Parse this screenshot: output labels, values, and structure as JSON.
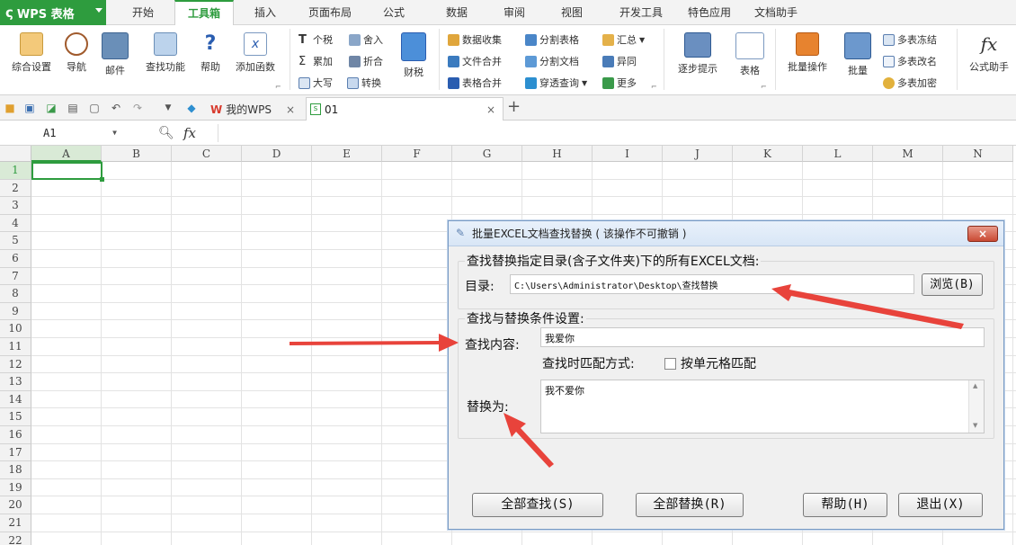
{
  "app": {
    "name": "WPS 表格"
  },
  "menu_tabs": [
    "开始",
    "工具箱",
    "插入",
    "页面布局",
    "公式",
    "数据",
    "审阅",
    "视图",
    "开发工具",
    "特色应用",
    "文档助手"
  ],
  "active_menu_tab": "工具箱",
  "ribbon": {
    "big_buttons": [
      "综合设置",
      "导航",
      "邮件",
      "查找功能",
      "帮助",
      "添加函数",
      "财税",
      "逐步提示",
      "表格",
      "批量操作",
      "批量",
      "公式助手"
    ],
    "small_buttons": [
      "个税",
      "舍入",
      "累加",
      "折合",
      "大写",
      "转换",
      "数据收集",
      "分割表格",
      "文件合并",
      "分割文档",
      "表格合并",
      "穿透查询",
      "汇总",
      "异同",
      "更多",
      "多表冻结",
      "多表改名",
      "多表加密"
    ]
  },
  "doc_tabs": [
    {
      "label": "我的WPS"
    },
    {
      "label": "01"
    }
  ],
  "formula_bar": {
    "cell_ref": "A1",
    "fx_label": "fx"
  },
  "columns": [
    "A",
    "B",
    "C",
    "D",
    "E",
    "F",
    "G",
    "H",
    "I",
    "J",
    "K",
    "L",
    "M",
    "N"
  ],
  "rows": [
    "1",
    "2",
    "3",
    "4",
    "5",
    "6",
    "7",
    "8",
    "9",
    "10",
    "11",
    "12",
    "13",
    "14",
    "15",
    "16",
    "17",
    "18",
    "19",
    "20",
    "21",
    "22"
  ],
  "dialog": {
    "title": "批量EXCEL文档查找替换 ( 该操作不可撤销 )",
    "section1_legend": "查找替换指定目录(含子文件夹)下的所有EXCEL文档:",
    "dir_label": "目录:",
    "dir_value": "C:\\Users\\Administrator\\Desktop\\查找替换",
    "browse_button": "浏览(B)",
    "section2_legend": "查找与替换条件设置:",
    "find_label": "查找内容:",
    "find_value": "我爱你",
    "match_label": "查找时匹配方式:",
    "match_checkbox_label": "按单元格匹配",
    "match_checked": false,
    "replace_label": "替换为:",
    "replace_value": "我不爱你",
    "find_all_button": "全部查找(S)",
    "replace_all_button": "全部替换(R)",
    "help_button": "帮助(H)",
    "exit_button": "退出(X)"
  },
  "colors": {
    "accent_green": "#2e9c3e",
    "arrow_red": "#e8433b",
    "dialog_border": "#7a9cc6"
  }
}
